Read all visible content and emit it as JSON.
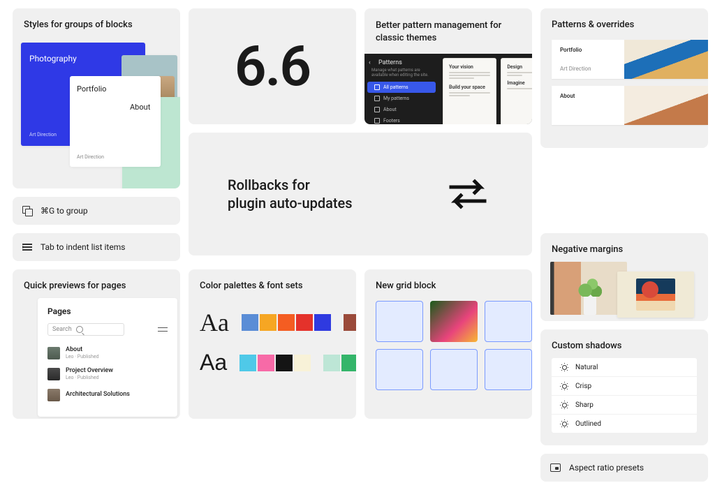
{
  "c1": {
    "title": "Styles for groups of blocks",
    "photography": "Photography",
    "portfolio": "Portfolio",
    "about": "About",
    "art_direction": "Art Direction"
  },
  "c1b": {
    "label": "⌘G to group"
  },
  "c1c": {
    "label": "Tab to indent list items"
  },
  "c2": {
    "value": "6.6"
  },
  "c3": {
    "line1": "Rollbacks for",
    "line2": "plugin auto-updates"
  },
  "c4": {
    "title": "Better pattern management for classic themes",
    "panel_title": "Patterns",
    "panel_sub": "Manage what patterns are available when editing the site.",
    "items": [
      "All patterns",
      "My patterns",
      "About",
      "Footers"
    ],
    "pane1_h": "Your vision",
    "pane1_h2": "Build your space",
    "pane2_h": "Design",
    "pane2_h2": "Imagine"
  },
  "c5": {
    "title": "Quick previews for pages",
    "panel_title": "Pages",
    "search_placeholder": "Search",
    "rows": [
      {
        "t": "About",
        "s": "Leo · Published"
      },
      {
        "t": "Project Overview",
        "s": "Leo · Published"
      },
      {
        "t": "Architectural Solutions",
        "s": ""
      }
    ]
  },
  "c6": {
    "title": "Color palettes & font sets",
    "aa1": "Aa",
    "aa2": "Aa",
    "row1": [
      "#5a8dd6",
      "#f6a623",
      "#f45d22",
      "#e4322b",
      "#2f3ae0"
    ],
    "row1b": [
      "#9a4a3a",
      "#3a6a78"
    ],
    "row2": [
      "#4fc9e8",
      "#f76aa7",
      "#141414",
      "#f8f2d8"
    ],
    "row2b": [
      "#bde6d6",
      "#34b56a"
    ]
  },
  "c7": {
    "title": "New grid block"
  },
  "r1": {
    "title": "Patterns & overrides",
    "rows": [
      {
        "t": "Portfolio",
        "s": "Art Direction"
      },
      {
        "t": "About",
        "s": ""
      }
    ]
  },
  "r2": {
    "title": "Negative margins"
  },
  "r3": {
    "title": "Custom shadows",
    "items": [
      "Natural",
      "Crisp",
      "Sharp",
      "Outlined"
    ]
  },
  "r4": {
    "label": "Aspect ratio presets"
  }
}
